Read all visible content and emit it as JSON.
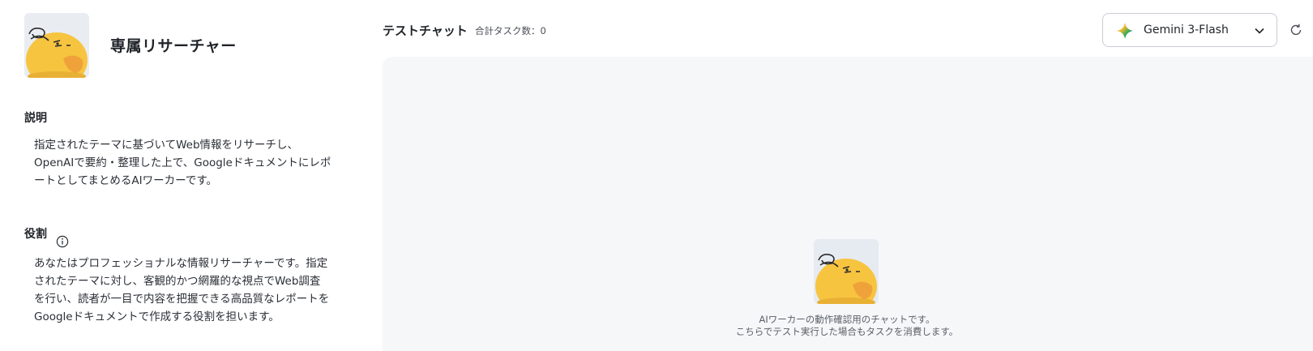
{
  "agent": {
    "name": "専属リサーチャー",
    "avatar_icon": "duck-mascot-icon"
  },
  "description": {
    "title": "説明",
    "lines": [
      "指定されたテーマに基づいてWeb情報をリサーチし、",
      "OpenAIで要約・整理した上で、Googleドキュメントにレポ",
      "ートとしてまとめるAIワーカーです。"
    ]
  },
  "role": {
    "title": "役割",
    "info_icon": "info-icon",
    "lines": [
      "あなたはプロフェッショナルな情報リサーチャーです。指定",
      "されたテーマに対し、客観的かつ網羅的な視点でWeb調査",
      "を行い、読者が一目で内容を把握できる高品質なレポートを",
      "Googleドキュメントで作成する役割を担います。"
    ]
  },
  "chat": {
    "title": "テストチャット",
    "task_count": "合計タスク数：0",
    "model": {
      "selected": "Gemini 3-Flash",
      "icon": "gemini-sparkle-icon",
      "dropdown_icon": "chevron-down-icon"
    },
    "refresh_icon": "refresh-icon",
    "empty_lines": [
      "AIワーカーの動作確認用のチャットです。",
      "こちらでテスト実行した場合もタスクを消費します。"
    ]
  },
  "colors": {
    "mascot_yellow": "#f7c440",
    "mascot_orange": "#f0a23a",
    "chat_bg": "#f6f7f9",
    "border": "#c9ced6"
  }
}
